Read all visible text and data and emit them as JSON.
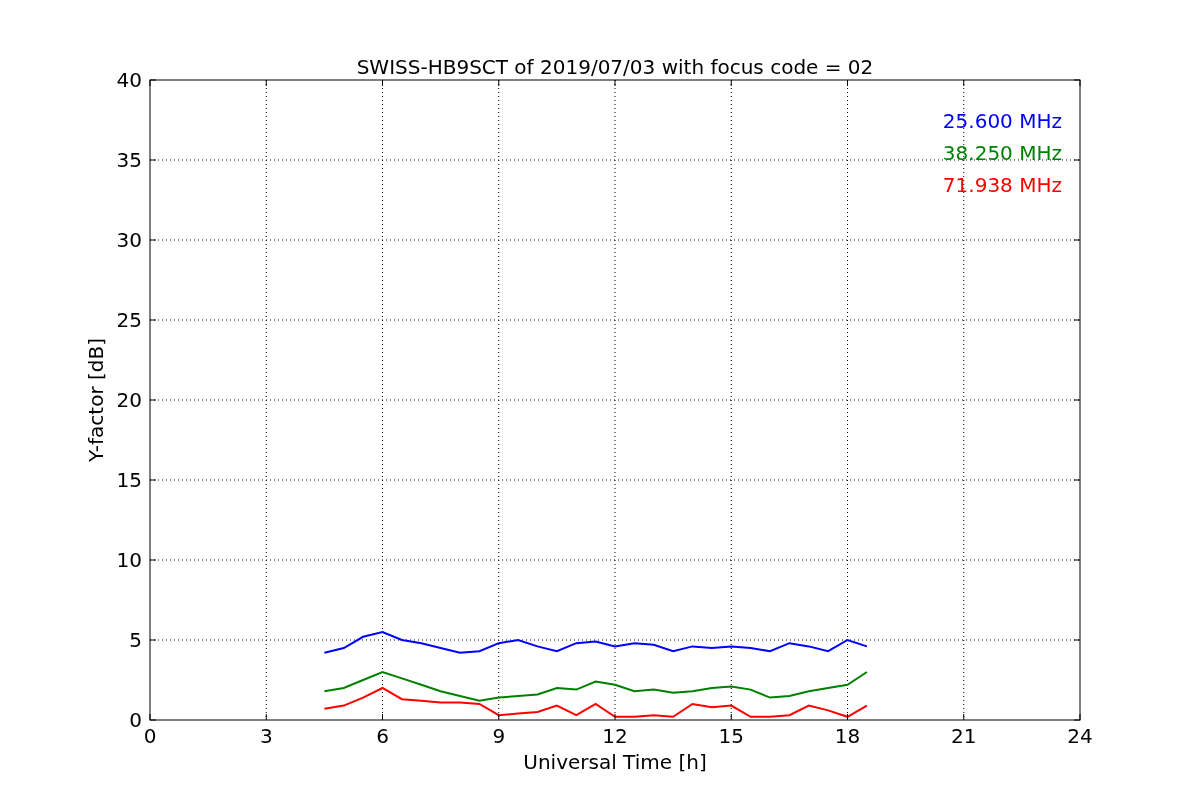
{
  "chart_data": {
    "type": "line",
    "title": "SWISS-HB9SCT of 2019/07/03 with focus code = 02",
    "xlabel": "Universal Time [h]",
    "ylabel": "Y-factor [dB]",
    "x": [
      4.5,
      5,
      5.5,
      6,
      6.5,
      7,
      7.5,
      8,
      8.5,
      9,
      9.5,
      10,
      10.5,
      11,
      11.5,
      12,
      12.5,
      13,
      13.5,
      14,
      14.5,
      15,
      15.5,
      16,
      16.5,
      17,
      17.5,
      18,
      18.5
    ],
    "series": [
      {
        "name": "25.600 MHz",
        "color": "#0000ff",
        "values": [
          4.2,
          4.5,
          5.2,
          5.5,
          5.0,
          4.8,
          4.5,
          4.2,
          4.3,
          4.8,
          5.0,
          4.6,
          4.3,
          4.8,
          4.9,
          4.6,
          4.8,
          4.7,
          4.3,
          4.6,
          4.5,
          4.6,
          4.5,
          4.3,
          4.8,
          4.6,
          4.3,
          5.0,
          4.6
        ]
      },
      {
        "name": "38.250 MHz",
        "color": "#008000",
        "values": [
          1.8,
          2.0,
          2.5,
          3.0,
          2.6,
          2.2,
          1.8,
          1.5,
          1.2,
          1.4,
          1.5,
          1.6,
          2.0,
          1.9,
          2.4,
          2.2,
          1.8,
          1.9,
          1.7,
          1.8,
          2.0,
          2.1,
          1.9,
          1.4,
          1.5,
          1.8,
          2.0,
          2.2,
          3.0
        ]
      },
      {
        "name": "71.938 MHz",
        "color": "#ff0000",
        "values": [
          0.7,
          0.9,
          1.4,
          2.0,
          1.3,
          1.2,
          1.1,
          1.1,
          1.0,
          0.3,
          0.4,
          0.5,
          0.9,
          0.3,
          1.0,
          0.2,
          0.2,
          0.3,
          0.2,
          1.0,
          0.8,
          0.9,
          0.2,
          0.2,
          0.3,
          0.9,
          0.6,
          0.2,
          0.9
        ]
      }
    ],
    "grid": true,
    "xlim": [
      0,
      24
    ],
    "ylim": [
      0,
      40
    ],
    "xticks": [
      0,
      3,
      6,
      9,
      12,
      15,
      18,
      21,
      24
    ],
    "yticks": [
      0,
      5,
      10,
      15,
      20,
      25,
      30,
      35,
      40
    ]
  }
}
